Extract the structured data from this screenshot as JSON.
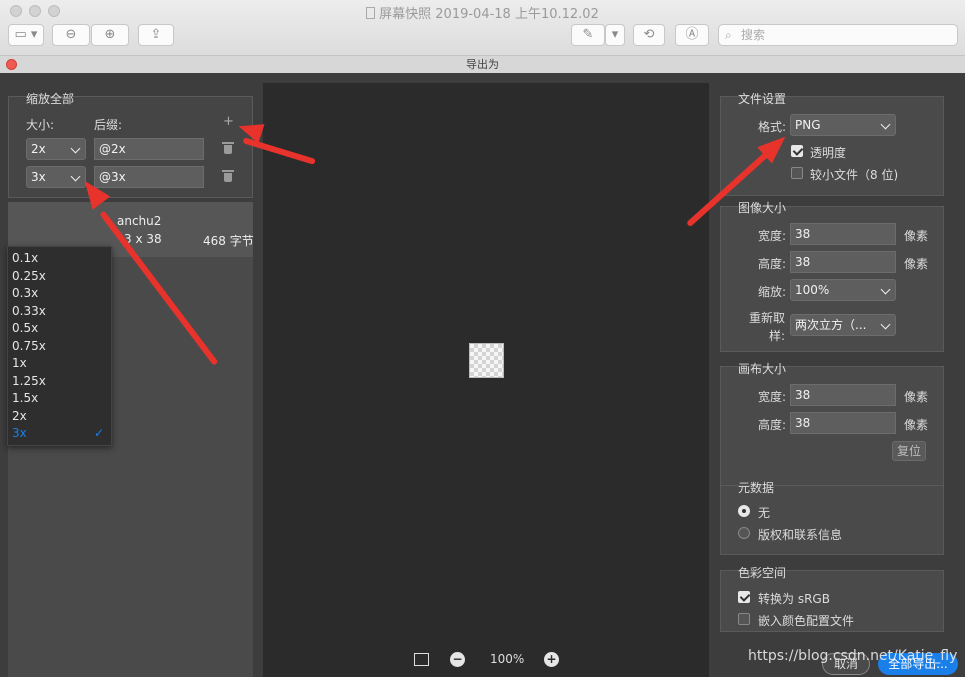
{
  "window": {
    "title": "屏幕快照 2019-04-18 上午10.12.02",
    "search_placeholder": "搜索"
  },
  "dialog": {
    "title": "导出为"
  },
  "scale_panel": {
    "title": "缩放全部",
    "col_size": "大小:",
    "col_suffix": "后缀:",
    "add": "+",
    "rows": [
      {
        "size": "2x",
        "suffix": "@2x"
      },
      {
        "size": "3x",
        "suffix": "@3x"
      }
    ],
    "file_name": "anchu2",
    "file_dims": "3 x 38",
    "file_size": "468 字节"
  },
  "dropdown_options": [
    "0.1x",
    "0.25x",
    "0.3x",
    "0.33x",
    "0.5x",
    "0.75x",
    "1x",
    "1.25x",
    "1.5x",
    "2x",
    "3x"
  ],
  "dropdown_selected": "3x",
  "preview": {
    "zoom": "100%"
  },
  "file_settings": {
    "title": "文件设置",
    "format_label": "格式:",
    "format_value": "PNG",
    "transparency": "透明度",
    "smaller_file": "较小文件（8 位)"
  },
  "image_size": {
    "title": "图像大小",
    "width_label": "宽度:",
    "width_value": "38",
    "width_unit": "像素",
    "height_label": "高度:",
    "height_value": "38",
    "height_unit": "像素",
    "scale_label": "缩放:",
    "scale_value": "100%",
    "resample_label_1": "重新取",
    "resample_label_2": "样:",
    "resample_value": "两次立方（..."
  },
  "canvas_size": {
    "title": "画布大小",
    "width_label": "宽度:",
    "width_value": "38",
    "width_unit": "像素",
    "height_label": "高度:",
    "height_value": "38",
    "height_unit": "像素",
    "reset": "复位"
  },
  "metadata": {
    "title": "元数据",
    "none": "无",
    "copyright": "版权和联系信息"
  },
  "color_space": {
    "title": "色彩空间",
    "convert": "转换为 sRGB",
    "embed": "嵌入颜色配置文件"
  },
  "footer": {
    "cancel": "取消",
    "export_all": "全部导出...",
    "watermark": "https://blog.csdn.net/Katie_fly"
  },
  "colors": {
    "accent": "#1a7fe8",
    "arrow": "#e8322c"
  }
}
